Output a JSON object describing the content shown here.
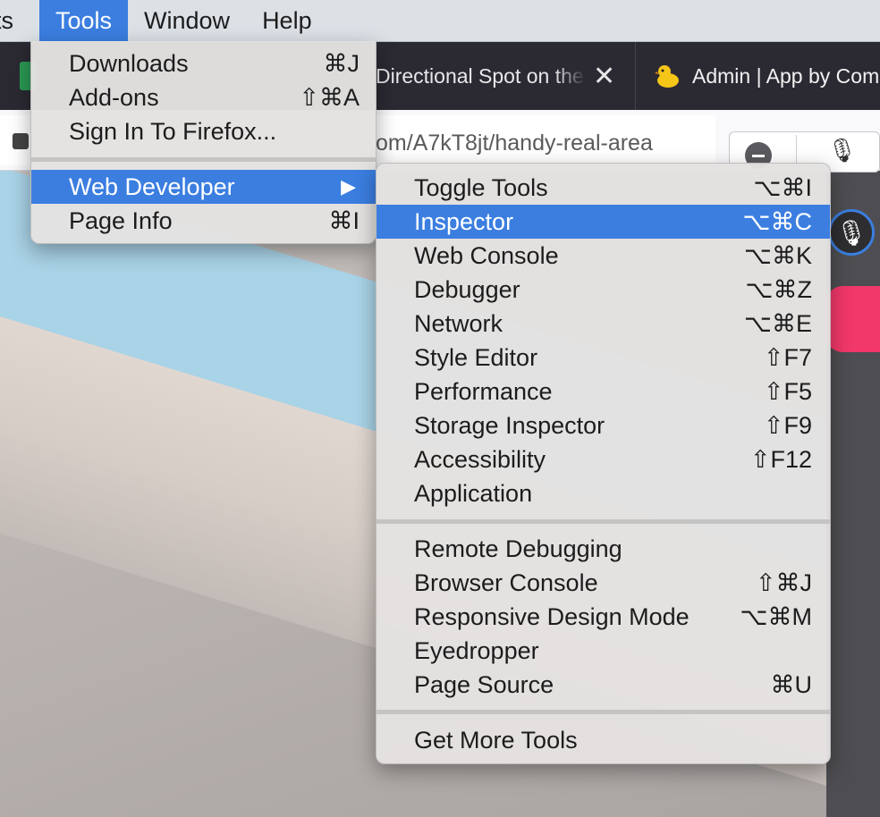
{
  "menubar": {
    "items": [
      "ts",
      "Tools",
      "Window",
      "Help"
    ]
  },
  "tabs": {
    "tab2_title": "Directional Spot on the",
    "tab2_close": "✕",
    "tab3_title": "Admin | App by Com"
  },
  "urlbar": {
    "url": "om/A7kT8jt/handy-real-area"
  },
  "tools_menu": {
    "items": [
      {
        "label": "Downloads",
        "shortcut": "⌘J"
      },
      {
        "label": "Add-ons",
        "shortcut": "⇧⌘A"
      },
      {
        "label": "Sign In To Firefox...",
        "shortcut": ""
      },
      {
        "label": "Web Developer",
        "shortcut": "▶"
      },
      {
        "label": "Page Info",
        "shortcut": "⌘I"
      }
    ]
  },
  "web_developer_menu": {
    "group1": [
      {
        "label": "Toggle Tools",
        "shortcut": "⌥⌘I"
      },
      {
        "label": "Inspector",
        "shortcut": "⌥⌘C"
      },
      {
        "label": "Web Console",
        "shortcut": "⌥⌘K"
      },
      {
        "label": "Debugger",
        "shortcut": "⌥⌘Z"
      },
      {
        "label": "Network",
        "shortcut": "⌥⌘E"
      },
      {
        "label": "Style Editor",
        "shortcut": "⇧F7"
      },
      {
        "label": "Performance",
        "shortcut": "⇧F5"
      },
      {
        "label": "Storage Inspector",
        "shortcut": "⇧F9"
      },
      {
        "label": "Accessibility",
        "shortcut": "⇧F12"
      },
      {
        "label": "Application",
        "shortcut": ""
      }
    ],
    "group2": [
      {
        "label": "Remote Debugging",
        "shortcut": ""
      },
      {
        "label": "Browser Console",
        "shortcut": "⇧⌘J"
      },
      {
        "label": "Responsive Design Mode",
        "shortcut": "⌥⌘M"
      },
      {
        "label": "Eyedropper",
        "shortcut": ""
      },
      {
        "label": "Page Source",
        "shortcut": "⌘U"
      }
    ],
    "group3": [
      {
        "label": "Get More Tools",
        "shortcut": ""
      }
    ]
  },
  "colors": {
    "highlight": "#3b7ee0",
    "menu_bg": "#e4e2e1",
    "tab_strip": "#2b2a33",
    "accent_pink": "#f2386a"
  }
}
